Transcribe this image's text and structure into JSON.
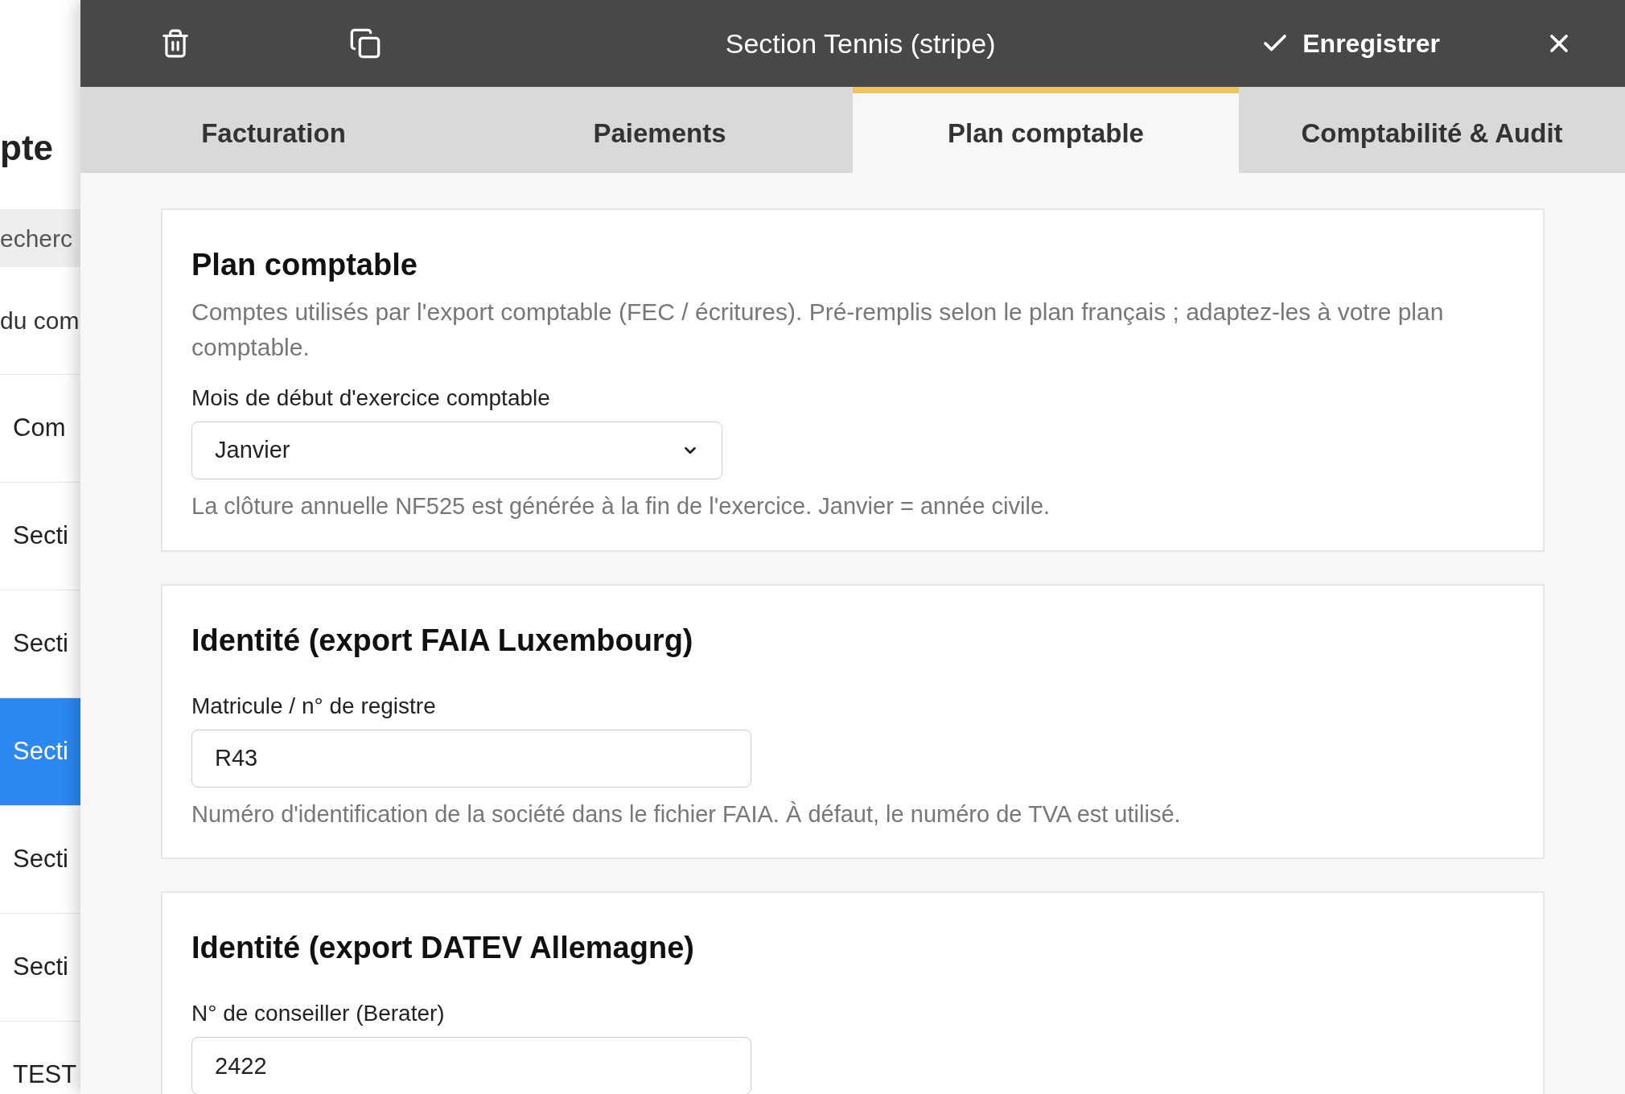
{
  "sidebar": {
    "heading": "pte",
    "search": {
      "value": "echerc"
    },
    "subtitle": "du com",
    "items": [
      {
        "label": "Com",
        "selected": false
      },
      {
        "label": "Secti",
        "selected": false
      },
      {
        "label": "Secti",
        "selected": false
      },
      {
        "label": "Secti",
        "selected": true
      },
      {
        "label": "Secti",
        "selected": false
      },
      {
        "label": "Secti",
        "selected": false
      },
      {
        "label": "TEST",
        "selected": false
      }
    ]
  },
  "header": {
    "title": "Section Tennis (stripe)",
    "save": "Enregistrer"
  },
  "tabs": [
    {
      "label": "Facturation",
      "selected": false
    },
    {
      "label": "Paiements",
      "selected": false
    },
    {
      "label": "Plan comptable",
      "selected": true
    },
    {
      "label": "Comptabilité & Audit",
      "selected": false
    }
  ],
  "cards": [
    {
      "title": "Plan comptable",
      "description": "Comptes utilisés par l'export comptable (FEC / écritures). Pré-remplis selon le plan français ; adaptez-les à votre plan comptable.",
      "field": {
        "kind": "select",
        "label": "Mois de début d'exercice comptable",
        "value": "Janvier",
        "help": "La clôture annuelle NF525 est générée à la fin de l'exercice. Janvier = année civile."
      }
    },
    {
      "title": "Identité (export FAIA Luxembourg)",
      "field": {
        "kind": "text",
        "label": "Matricule / n° de registre",
        "value": "R43",
        "help": "Numéro d'identification de la société dans le fichier FAIA. À défaut, le numéro de TVA est utilisé."
      }
    },
    {
      "title": "Identité (export DATEV Allemagne)",
      "field": {
        "kind": "text",
        "label": "N° de conseiller (Berater)",
        "value": "2422"
      }
    }
  ]
}
